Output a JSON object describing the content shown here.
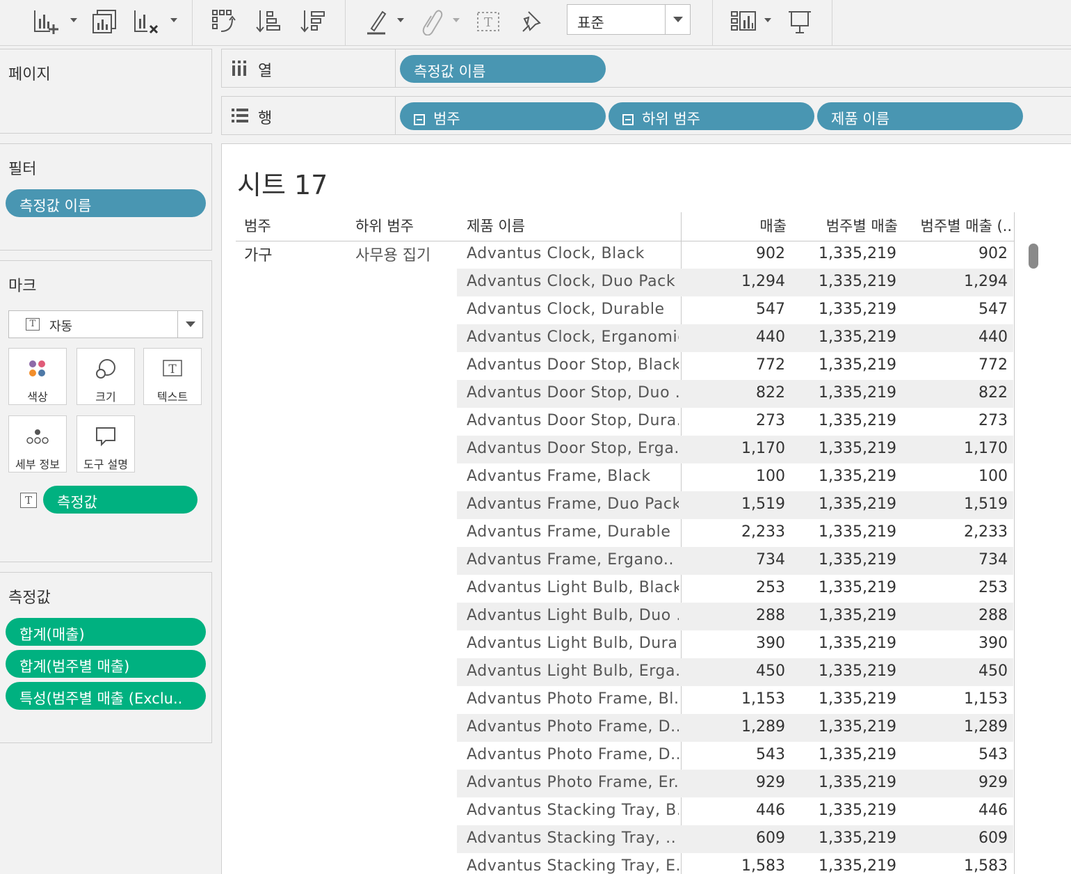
{
  "toolbar": {
    "icons": [
      "new-worksheet-icon",
      "duplicate-sheet-icon",
      "clear-sheet-icon",
      "swap-rows-columns-icon",
      "sort-ascending-icon",
      "sort-descending-icon",
      "highlight-icon",
      "group-members-icon",
      "show-mark-labels-icon",
      "pin-axes-icon",
      "show-me-icon",
      "presentation-mode-icon"
    ],
    "fit_select": "표준"
  },
  "pages": {
    "title": "페이지"
  },
  "shelves": {
    "columns": {
      "label": "열",
      "pills": [
        "측정값 이름"
      ]
    },
    "rows": {
      "label": "행",
      "pills": [
        "범주",
        "하위 범주",
        "제품 이름"
      ]
    }
  },
  "filters": {
    "title": "필터",
    "pills": [
      "측정값 이름"
    ]
  },
  "marks": {
    "title": "마크",
    "type": "자동",
    "buttons": {
      "color": "색상",
      "size": "크기",
      "text": "텍스트",
      "detail": "세부 정보",
      "tooltip": "도구 설명"
    },
    "text_pill": "측정값"
  },
  "measure_values": {
    "title": "측정값",
    "pills": [
      "합계(매출)",
      "합계(범주별 매출)",
      "특성(범주별 매출 (Exclu.."
    ]
  },
  "sheet": {
    "title": "시트 17",
    "headers": {
      "category": "범주",
      "subcategory": "하위 범주",
      "product": "제품 이름",
      "sales": "매출",
      "category_sales": "범주별 매출",
      "category_sales_excl": "범주별 매출 (.."
    },
    "category": "가구",
    "subcategory": "사무용 집기",
    "rows": [
      {
        "product": "Advantus Clock, Black",
        "sales": "902",
        "category_sales": "1,335,219",
        "category_sales_excl": "902"
      },
      {
        "product": "Advantus Clock, Duo Pack",
        "sales": "1,294",
        "category_sales": "1,335,219",
        "category_sales_excl": "1,294"
      },
      {
        "product": "Advantus Clock, Durable",
        "sales": "547",
        "category_sales": "1,335,219",
        "category_sales_excl": "547"
      },
      {
        "product": "Advantus Clock, Erganomic",
        "sales": "440",
        "category_sales": "1,335,219",
        "category_sales_excl": "440"
      },
      {
        "product": "Advantus Door Stop, Black",
        "sales": "772",
        "category_sales": "1,335,219",
        "category_sales_excl": "772"
      },
      {
        "product": "Advantus Door Stop, Duo ..",
        "sales": "822",
        "category_sales": "1,335,219",
        "category_sales_excl": "822"
      },
      {
        "product": "Advantus Door Stop, Dura..",
        "sales": "273",
        "category_sales": "1,335,219",
        "category_sales_excl": "273"
      },
      {
        "product": "Advantus Door Stop, Erga..",
        "sales": "1,170",
        "category_sales": "1,335,219",
        "category_sales_excl": "1,170"
      },
      {
        "product": "Advantus Frame, Black",
        "sales": "100",
        "category_sales": "1,335,219",
        "category_sales_excl": "100"
      },
      {
        "product": "Advantus Frame, Duo Pack",
        "sales": "1,519",
        "category_sales": "1,335,219",
        "category_sales_excl": "1,519"
      },
      {
        "product": "Advantus Frame, Durable",
        "sales": "2,233",
        "category_sales": "1,335,219",
        "category_sales_excl": "2,233"
      },
      {
        "product": "Advantus Frame, Ergano..",
        "sales": "734",
        "category_sales": "1,335,219",
        "category_sales_excl": "734"
      },
      {
        "product": "Advantus Light Bulb, Black",
        "sales": "253",
        "category_sales": "1,335,219",
        "category_sales_excl": "253"
      },
      {
        "product": "Advantus Light Bulb, Duo ..",
        "sales": "288",
        "category_sales": "1,335,219",
        "category_sales_excl": "288"
      },
      {
        "product": "Advantus Light Bulb, Dura..",
        "sales": "390",
        "category_sales": "1,335,219",
        "category_sales_excl": "390"
      },
      {
        "product": "Advantus Light Bulb, Erga..",
        "sales": "450",
        "category_sales": "1,335,219",
        "category_sales_excl": "450"
      },
      {
        "product": "Advantus Photo Frame, Bl..",
        "sales": "1,153",
        "category_sales": "1,335,219",
        "category_sales_excl": "1,153"
      },
      {
        "product": "Advantus Photo Frame, D..",
        "sales": "1,289",
        "category_sales": "1,335,219",
        "category_sales_excl": "1,289"
      },
      {
        "product": "Advantus Photo Frame, D..",
        "sales": "543",
        "category_sales": "1,335,219",
        "category_sales_excl": "543"
      },
      {
        "product": "Advantus Photo Frame, Er..",
        "sales": "929",
        "category_sales": "1,335,219",
        "category_sales_excl": "929"
      },
      {
        "product": "Advantus Stacking Tray, B..",
        "sales": "446",
        "category_sales": "1,335,219",
        "category_sales_excl": "446"
      },
      {
        "product": "Advantus Stacking Tray, ..",
        "sales": "609",
        "category_sales": "1,335,219",
        "category_sales_excl": "609"
      },
      {
        "product": "Advantus Stacking Tray, E..",
        "sales": "1,583",
        "category_sales": "1,335,219",
        "category_sales_excl": "1,583"
      }
    ]
  },
  "colors": {
    "dimension_pill": "#4996b2",
    "measure_pill": "#00b180",
    "band_row": "#efefef",
    "background": "#f2f2f2"
  }
}
